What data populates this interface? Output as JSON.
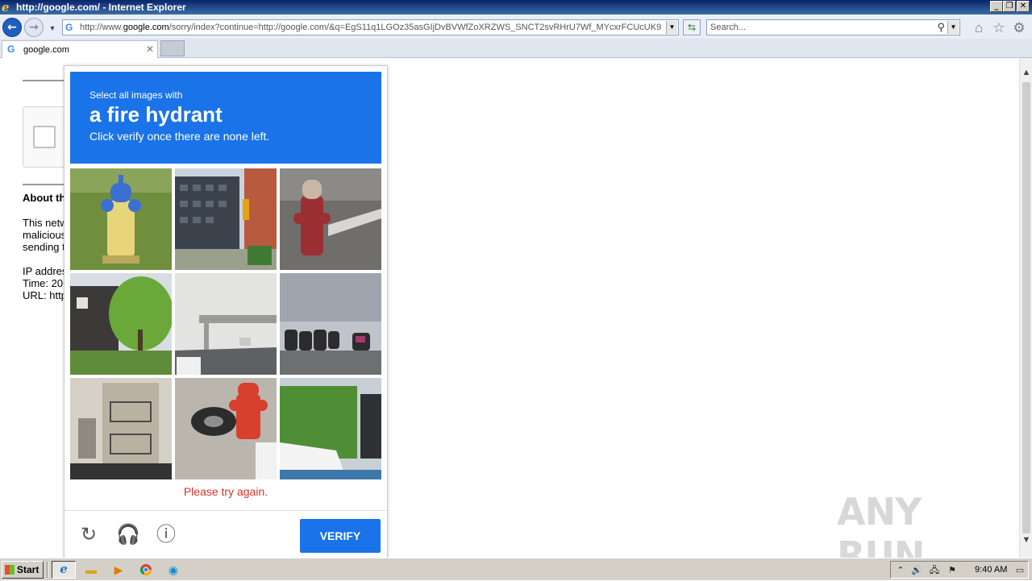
{
  "window": {
    "title": "http://google.com/ - Internet Explorer"
  },
  "navbar": {
    "url_prefix": "http://www.",
    "url_domain": "google.com",
    "url_rest": "/sorry/index?continue=http://google.com/&q=EgS11q1LGOz35asGIjDvBVWfZoXRZWS_SNCT2svRHrU7Wf_MYcxrFCUcUK9Iiqo",
    "search_placeholder": "Search..."
  },
  "tabs": [
    {
      "label": "google.com"
    }
  ],
  "page": {
    "about_heading": "About th",
    "para1": [
      "This netw",
      "malicious",
      "sending t"
    ],
    "para2": [
      "IP addres",
      "Time: 20",
      "URL: http"
    ]
  },
  "captcha": {
    "instruction_line1": "Select all images with",
    "target": "a fire hydrant",
    "instruction_line3": "Click verify once there are none left.",
    "error_message": "Please try again.",
    "verify_label": "VERIFY",
    "tiles": [
      {
        "name": "tile-yellow-hydrant",
        "content": "yellow fire hydrant on grass"
      },
      {
        "name": "tile-buildings-traffic-light",
        "content": "street with buildings and traffic light"
      },
      {
        "name": "tile-red-hydrant-street",
        "content": "red fire hydrant by road"
      },
      {
        "name": "tile-house-tree",
        "content": "house with tree"
      },
      {
        "name": "tile-road-overpass",
        "content": "road with overpass"
      },
      {
        "name": "tile-motorcycles",
        "content": "parked motorcycles"
      },
      {
        "name": "tile-building-balcony",
        "content": "building with balconies"
      },
      {
        "name": "tile-red-hydrant-tire",
        "content": "red fire hydrant with tire"
      },
      {
        "name": "tile-hedge-boat",
        "content": "hedge and boat"
      }
    ],
    "colors": {
      "header": "#1a73e8",
      "verify_button": "#1a73e8",
      "error": "#d93025"
    }
  },
  "watermark": "ANY RUN",
  "taskbar": {
    "start_label": "Start",
    "clock": "9:40 AM"
  }
}
